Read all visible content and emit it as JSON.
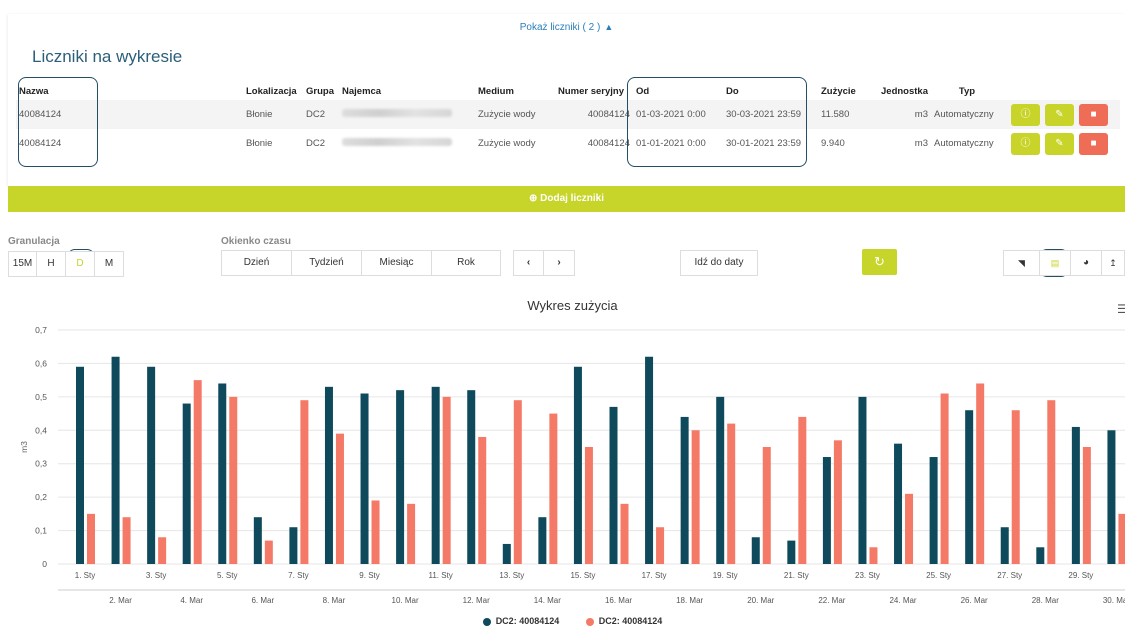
{
  "panel": {
    "toggle_label": "Pokaż liczniki ( 2 )",
    "title": "Liczniki na wykresie",
    "add_label": "Dodaj liczniki",
    "headers": [
      "Nazwa",
      "Lokalizacja",
      "Grupa",
      "Najemca",
      "Medium",
      "Numer seryjny",
      "Od",
      "Do",
      "Zużycie",
      "Jednostka",
      "Typ"
    ],
    "rows": [
      {
        "nazwa": "40084124",
        "lokalizacja": "Błonie",
        "grupa": "DC2",
        "medium": "Zużycie wody",
        "numer": "40084124",
        "od": "01-03-2021 0:00",
        "do": "30-03-2021 23:59",
        "zuzycie": "11.580",
        "jednostka": "m3",
        "typ": "Automatyczny"
      },
      {
        "nazwa": "40084124",
        "lokalizacja": "Błonie",
        "grupa": "DC2",
        "medium": "Zużycie wody",
        "numer": "40084124",
        "od": "01-01-2021 0:00",
        "do": "30-01-2021 23:59",
        "zuzycie": "9.940",
        "jednostka": "m3",
        "typ": "Automatyczny"
      }
    ]
  },
  "controls": {
    "granulacja_label": "Granulacja",
    "granulacja": [
      "15M",
      "H",
      "D",
      "M"
    ],
    "granulacja_active": "D",
    "okienko_label": "Okienko czasu",
    "okienko": [
      "Dzień",
      "Tydzień",
      "Miesiąc",
      "Rok"
    ],
    "prev": "‹",
    "next": "›",
    "goto_label": "Idź do daty"
  },
  "colors": {
    "series_a": "#0e4a5c",
    "series_b": "#f47a67",
    "accent": "#c7d52a"
  },
  "chart_data": {
    "type": "bar",
    "title": "Wykres zużycia",
    "ylabel": "m3",
    "ylim": [
      0,
      0.7
    ],
    "yticks": [
      "0",
      "0,1",
      "0,2",
      "0,3",
      "0,4",
      "0,5",
      "0,6",
      "0,7"
    ],
    "x_top_labels": [
      "1. Sty",
      "3. Sty",
      "5. Sty",
      "7. Sty",
      "9. Sty",
      "11. Sty",
      "13. Sty",
      "15. Sty",
      "17. Sty",
      "19. Sty",
      "21. Sty",
      "23. Sty",
      "25. Sty",
      "27. Sty",
      "29. Sty"
    ],
    "x_bottom_labels": [
      "2. Mar",
      "4. Mar",
      "6. Mar",
      "8. Mar",
      "10. Mar",
      "12. Mar",
      "14. Mar",
      "16. Mar",
      "18. Mar",
      "20. Mar",
      "22. Mar",
      "24. Mar",
      "26. Mar",
      "28. Mar",
      "30. Mar"
    ],
    "series": [
      {
        "name": "DC2: 40084124",
        "values": [
          0.59,
          0.62,
          0.59,
          0.48,
          0.54,
          0.14,
          0.11,
          0.53,
          0.51,
          0.52,
          0.53,
          0.52,
          0.06,
          0.14,
          0.59,
          0.47,
          0.62,
          0.44,
          0.5,
          0.08,
          0.07,
          0.32,
          0.5,
          0.36,
          0.32,
          0.46,
          0.11,
          0.05,
          0.41,
          0.4
        ]
      },
      {
        "name": "DC2: 40084124",
        "values": [
          0.15,
          0.14,
          0.08,
          0.55,
          0.5,
          0.07,
          0.49,
          0.39,
          0.19,
          0.18,
          0.5,
          0.38,
          0.49,
          0.45,
          0.35,
          0.18,
          0.11,
          0.4,
          0.42,
          0.35,
          0.44,
          0.37,
          0.05,
          0.21,
          0.51,
          0.54,
          0.46,
          0.49,
          0.35,
          0.15
        ]
      }
    ],
    "legend_position": "bottom",
    "grid": true
  }
}
